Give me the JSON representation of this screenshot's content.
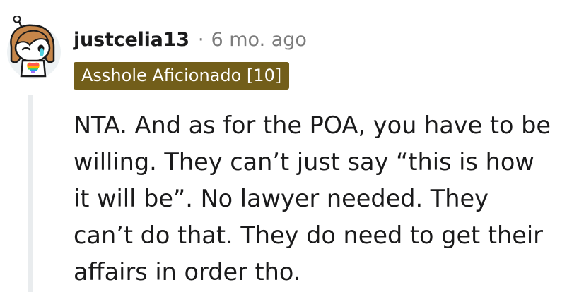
{
  "comment": {
    "author": "justcelia13",
    "separator": "·",
    "time_ago": "6 mo. ago",
    "flair": "Asshole Aficionado [10]",
    "body": "NTA. And as for the POA, you have to be willing. They can’t just say “this is how it will be”. No lawyer needed. They can’t do that. They do need to get their affairs in order tho."
  },
  "colors": {
    "flair_background": "#725e1a",
    "flair_text": "#ffffff",
    "meta_text": "#7c7c7c",
    "thread_line": "#e9ecee"
  },
  "icons": {
    "avatar": "snoo-avatar-icon"
  }
}
